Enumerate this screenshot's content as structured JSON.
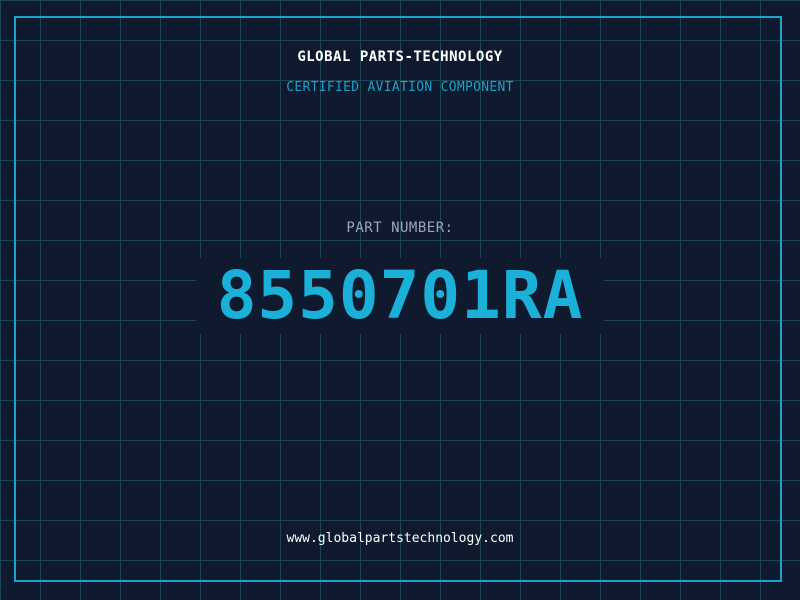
{
  "header": {
    "company": "GLOBAL PARTS-TECHNOLOGY",
    "tagline": "CERTIFIED AVIATION COMPONENT"
  },
  "part": {
    "label": "PART NUMBER:",
    "number": "8550701RA"
  },
  "footer": {
    "website": "www.globalpartstechnology.com"
  },
  "colors": {
    "background": "#0f1a2e",
    "grid": "#1d4558",
    "accent": "#1ab0d8",
    "frame": "#1ba3c9"
  }
}
